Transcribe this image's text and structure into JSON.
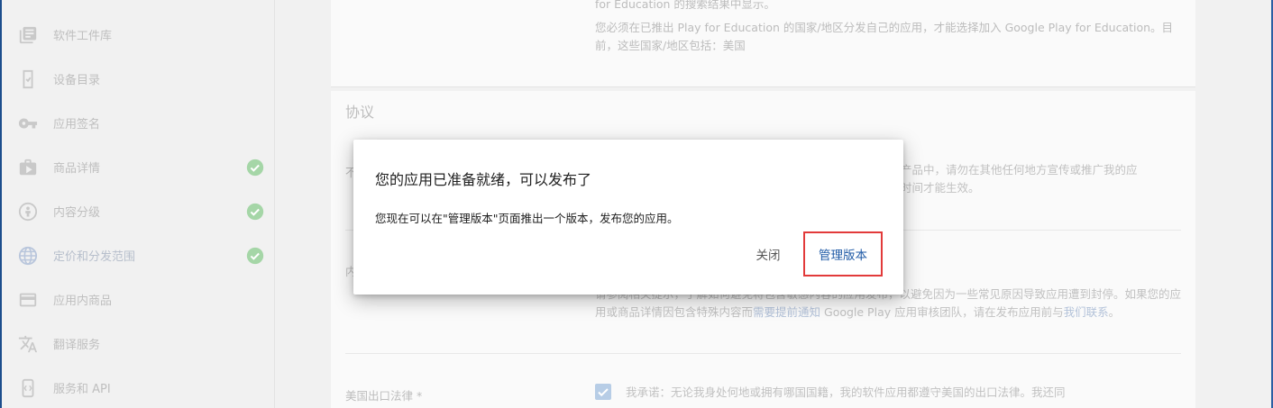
{
  "sidebar": {
    "items": [
      {
        "label": "软件工件库",
        "icon": "library-icon",
        "checked": false
      },
      {
        "label": "设备目录",
        "icon": "device-catalog-icon",
        "checked": false
      },
      {
        "label": "应用签名",
        "icon": "key-icon",
        "checked": false
      },
      {
        "label": "商品详情",
        "icon": "store-listing-icon",
        "checked": true
      },
      {
        "label": "内容分级",
        "icon": "content-rating-icon",
        "checked": true
      },
      {
        "label": "定价和分发范围",
        "icon": "globe-icon",
        "checked": true
      },
      {
        "label": "应用内商品",
        "icon": "in-app-products-icon",
        "checked": false
      },
      {
        "label": "翻译服务",
        "icon": "translate-icon",
        "checked": false
      },
      {
        "label": "服务和 API",
        "icon": "services-api-icon",
        "checked": false
      }
    ],
    "check_color": "#a5d6a7"
  },
  "main": {
    "top_card": {
      "line1": "for Education 的搜索结果中显示。",
      "line2": "您必须在已推出 Play for Education 的国家/地区分发自己的应用，才能选择加入 Google Play for Education。目前，这些国家/地区包括：美国"
    },
    "agreement": {
      "title": "协议",
      "row1_label": "不",
      "row1_text": "产品中，请勿在其他任何地方宣传或推广我的应",
      "row1_text2": "时间才能生效。",
      "row2_label": "内",
      "row2_text_a": "请参阅相关提示，了解如何避免将包含敏感内容的应用发布，以避免因为一些常见原因导致应用遭到封停。如果您的应用或商品详情因包含特殊内容而",
      "row2_link": "需要提前通知",
      "row2_text_b": " Google Play 应用审核团队，请在发布应用前与",
      "row2_link2": "我们联系",
      "row2_text_c": "。",
      "export_label": "美国出口法律 *",
      "export_text": "我承诺：无论我身处何地或拥有哪国国籍，我的软件应用都遵守美国的出口法律。我还同"
    }
  },
  "dialog": {
    "title": "您的应用已准备就绪，可以发布了",
    "body": "您现在可以在\"管理版本\"页面推出一个版本，发布您的应用。",
    "close_label": "关闭",
    "manage_label": "管理版本",
    "highlight_color": "#e23a3a",
    "primary_color": "#1f5aa6"
  }
}
